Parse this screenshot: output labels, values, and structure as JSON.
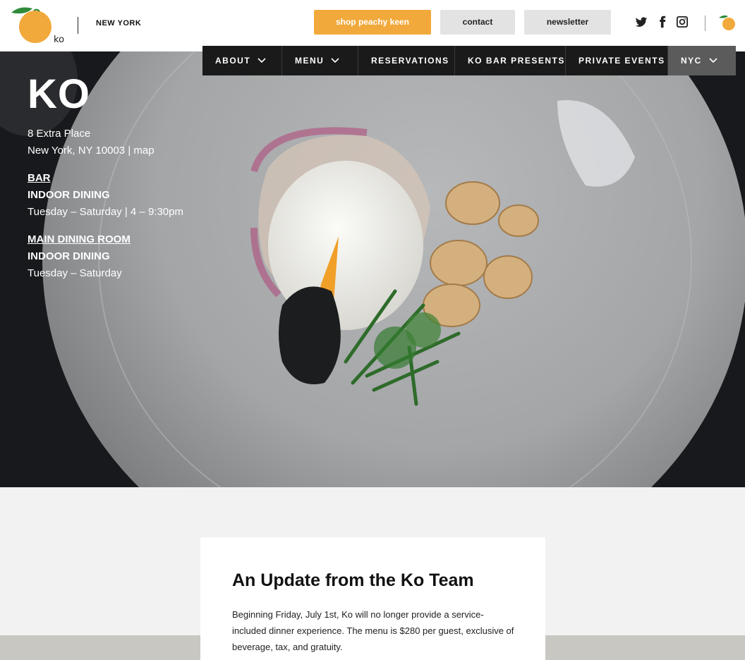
{
  "header": {
    "logo_text": "ko",
    "city": "NEW YORK",
    "shop_label": "shop peachy keen",
    "contact_label": "contact",
    "newsletter_label": "newsletter",
    "social_icons": [
      "twitter-icon",
      "facebook-icon",
      "instagram-icon"
    ],
    "accent_color": "#f2a93b"
  },
  "nav": {
    "items": [
      {
        "label": "ABOUT",
        "has_dropdown": true
      },
      {
        "label": "MENU",
        "has_dropdown": true
      },
      {
        "label": "RESERVATIONS",
        "has_dropdown": false
      },
      {
        "label": "KO BAR PRESENTS",
        "has_dropdown": false
      },
      {
        "label": "PRIVATE EVENTS",
        "has_dropdown": false
      },
      {
        "label": "NYC",
        "has_dropdown": true
      }
    ]
  },
  "hero": {
    "title": "KO",
    "address_line1": "8 Extra Place",
    "address_line2": "New York, NY 10003 | map",
    "bar": {
      "label": "BAR",
      "dining": "INDOOR DINING",
      "hours": "Tuesday – Saturday  |  4 – 9:30pm"
    },
    "main": {
      "label": "MAIN DINING ROOM",
      "dining": "INDOOR DINING",
      "hours": "Tuesday – Saturday"
    }
  },
  "update": {
    "title": "An Update from the Ko Team",
    "body": "Beginning Friday, July 1st, Ko will no longer provide a service-included dinner experience. The menu is $280 per guest, exclusive of beverage, tax, and gratuity."
  }
}
